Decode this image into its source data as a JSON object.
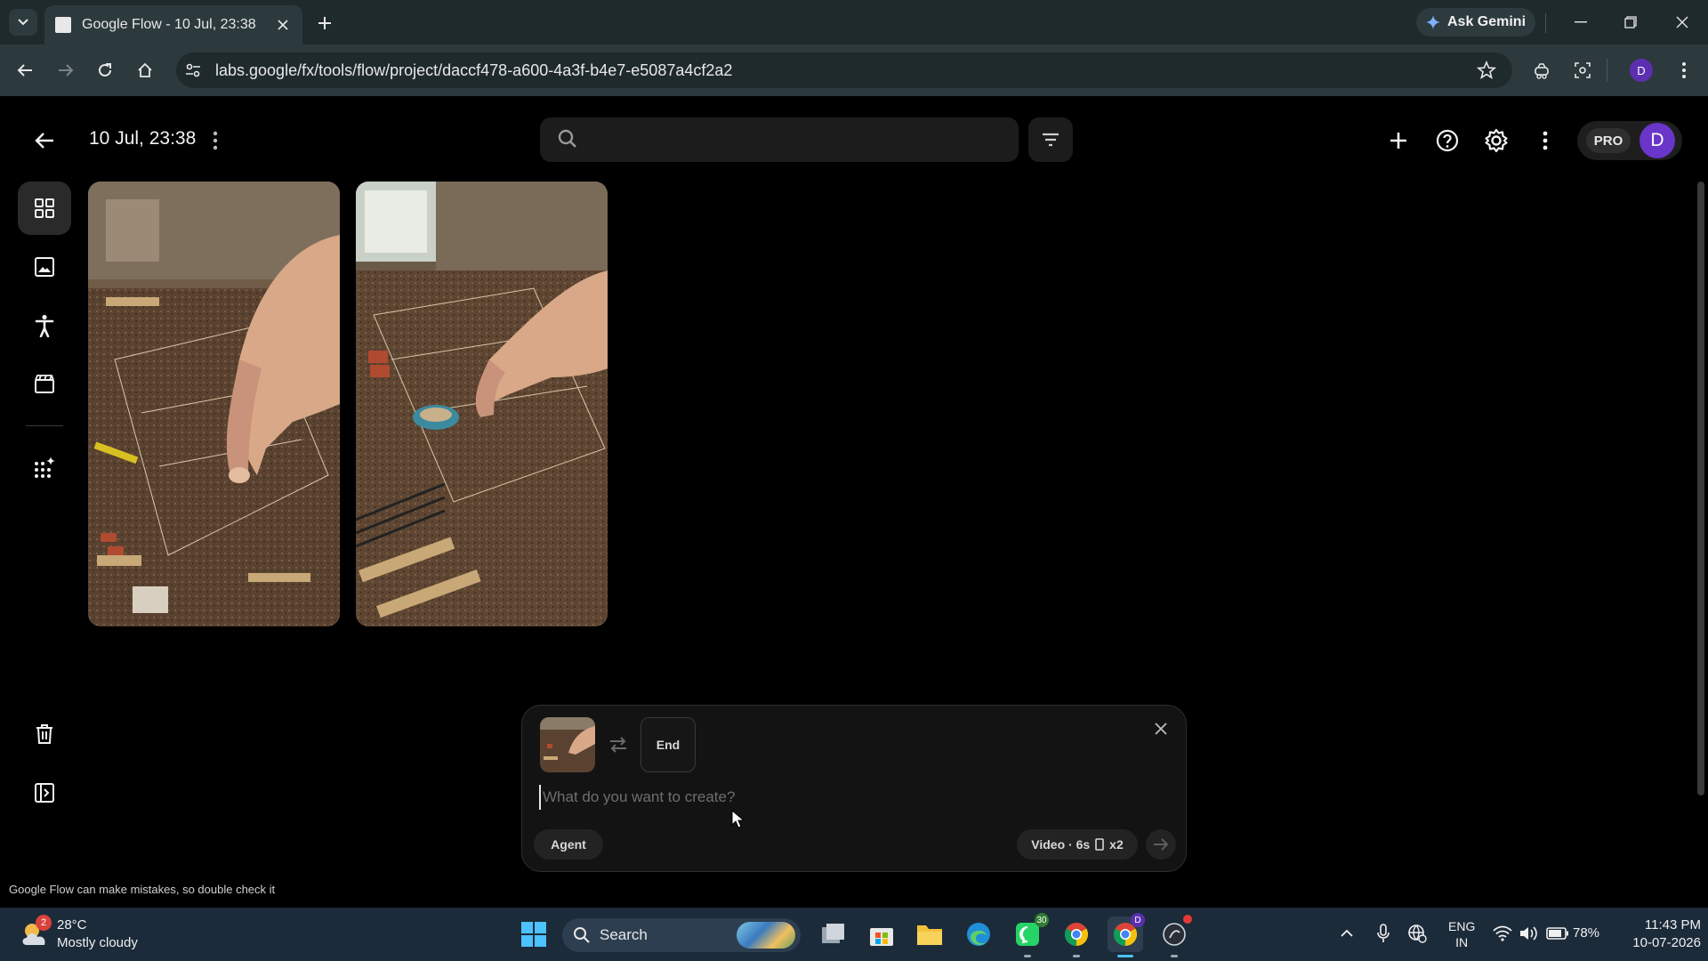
{
  "browser": {
    "tab_title": "Google Flow - 10 Jul, 23:38",
    "ask_gemini_label": "Ask Gemini",
    "url": "labs.google/fx/tools/flow/project/daccf478-a600-4a3f-b4e7-e5087a4cf2a2",
    "profile_initial": "D"
  },
  "app": {
    "project_title": "10 Jul, 23:38",
    "search_placeholder": "",
    "pro_label": "PRO",
    "user_initial": "D",
    "rail_items": [
      "grid-icon",
      "image-icon",
      "person-icon",
      "clapperboard-icon",
      "sparkle-grid-icon",
      "trash-icon",
      "panel-icon"
    ],
    "gallery": [
      {
        "description_icon": "image-thumbnail"
      },
      {
        "description_icon": "image-thumbnail"
      }
    ],
    "prompt_panel": {
      "end_frame_label": "End",
      "placeholder": "What do you want to create?",
      "agent_label": "Agent",
      "settings_label": "Video · 6s",
      "count_label": "x2"
    },
    "disclaimer": "Google Flow can make mistakes, so double check it"
  },
  "taskbar": {
    "weather_badge": "2",
    "temperature": "28°C",
    "weather_desc": "Mostly cloudy",
    "search_label": "Search",
    "whatsapp_badge": "30",
    "lang_line1": "ENG",
    "lang_line2": "IN",
    "battery": "78%",
    "time": "11:43 PM",
    "date": "10-07-2026"
  },
  "colors": {
    "accent_purple": "#6a35c9",
    "app_bg": "#000000",
    "chrome_bg": "#2c3a3e",
    "taskbar_bg": "#1c2b3a"
  }
}
